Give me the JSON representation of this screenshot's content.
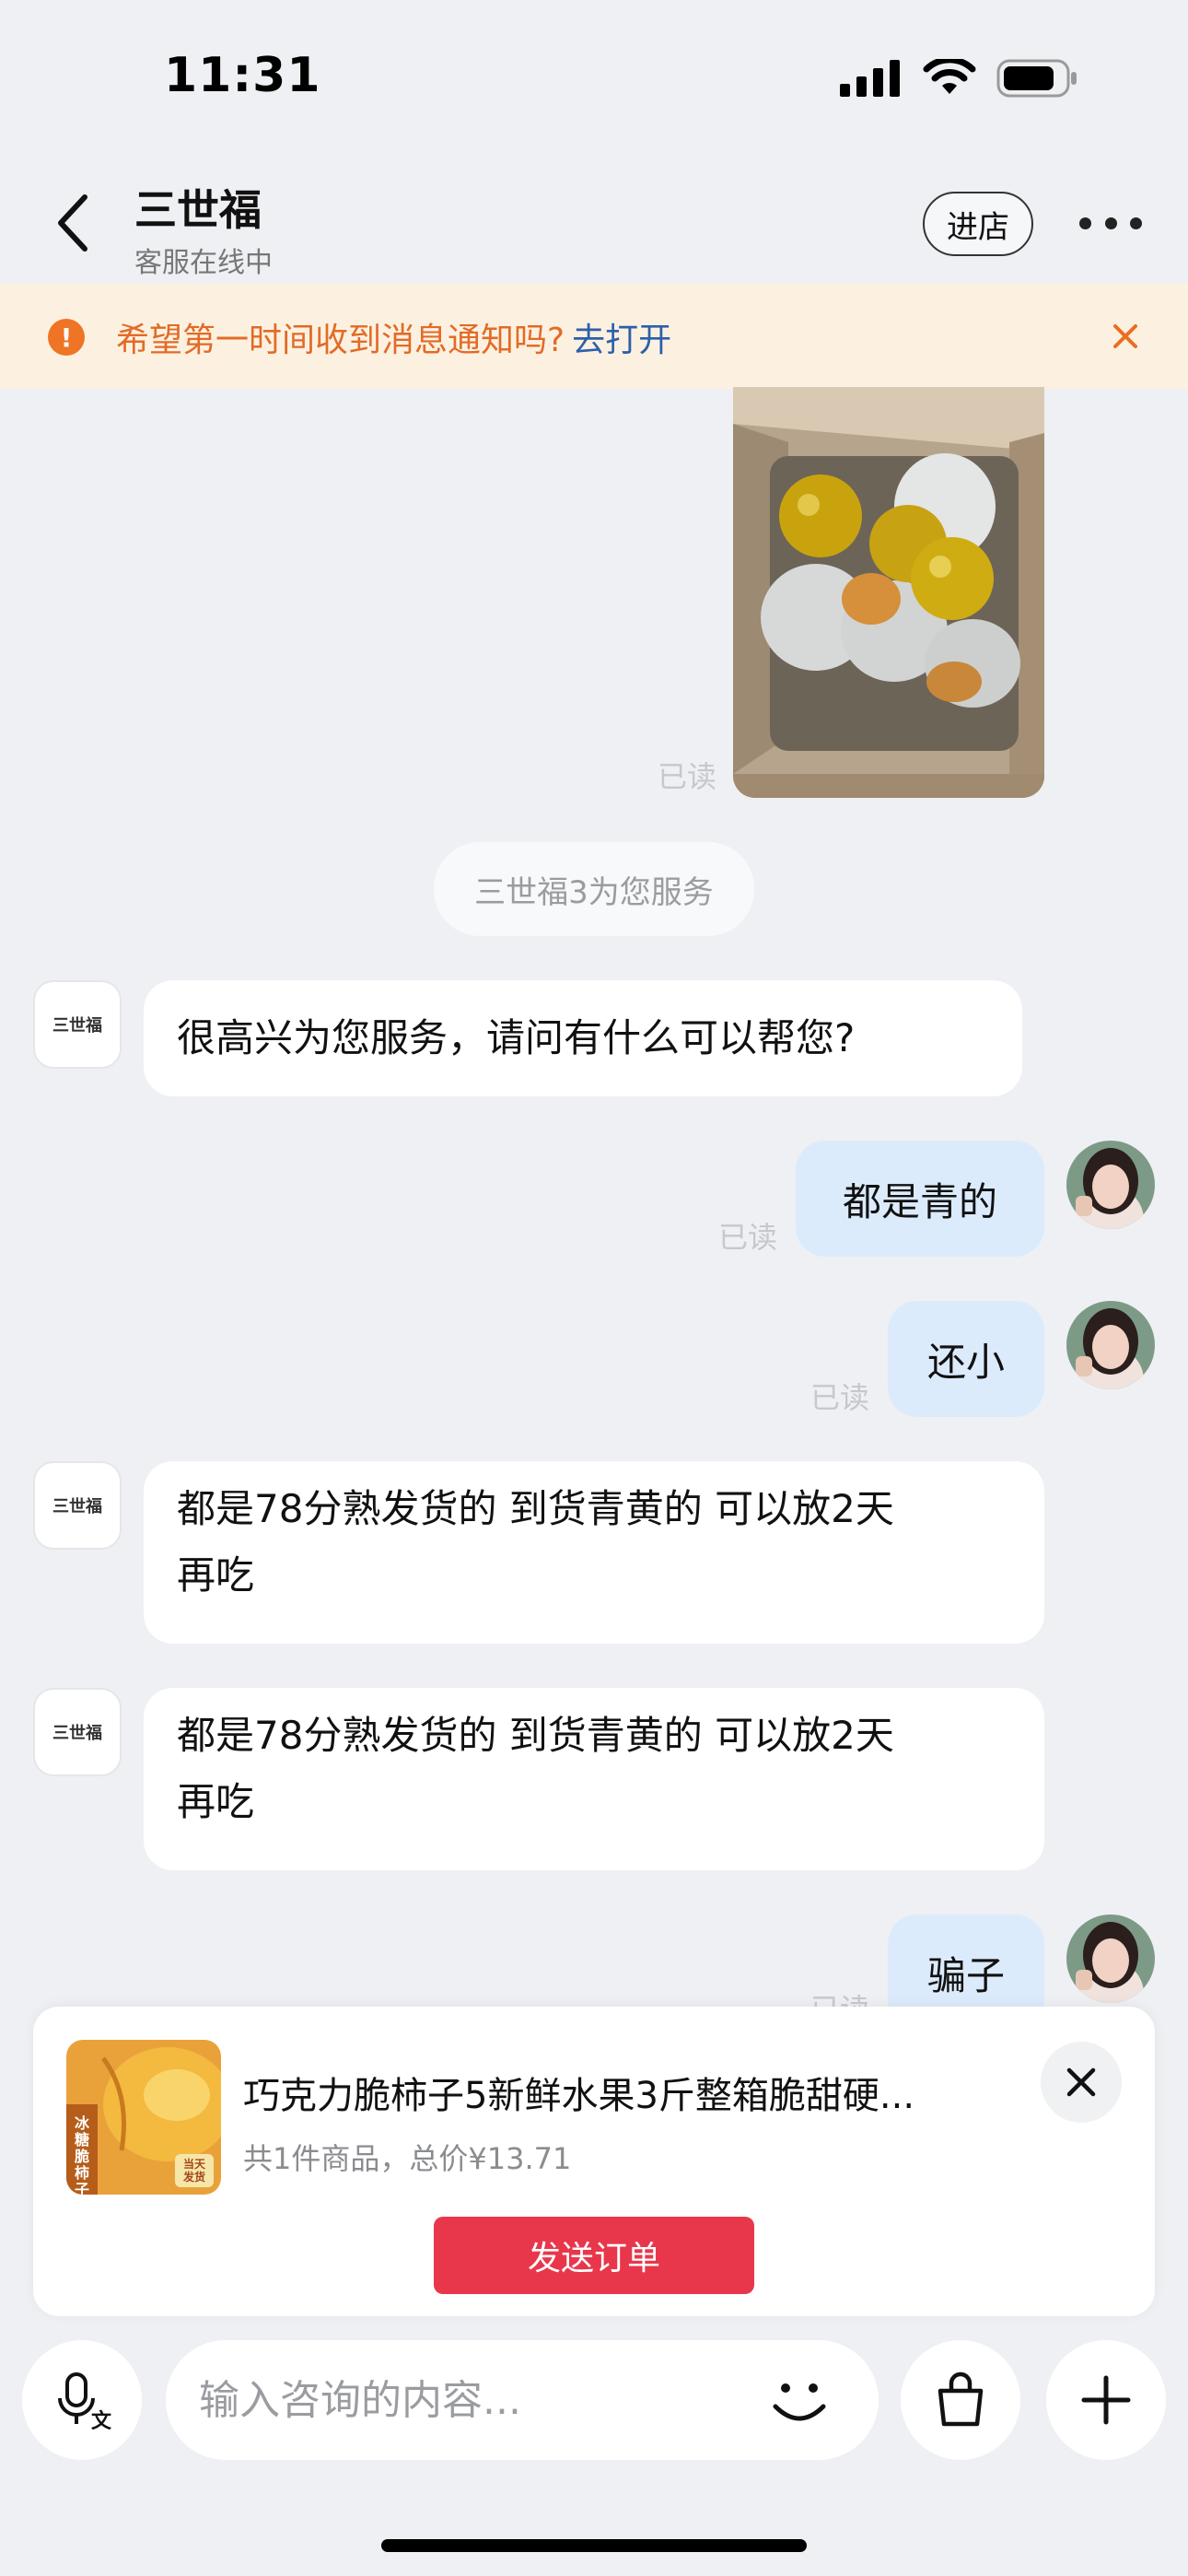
{
  "status_bar": {
    "time": "11:31"
  },
  "header": {
    "shop_name": "三世福",
    "shop_status": "客服在线中",
    "enter_shop_label": "进店"
  },
  "notice": {
    "text": "希望第一时间收到消息通知吗?",
    "link": "去打开"
  },
  "messages": {
    "photo_read": "已读",
    "system_chip": "三世福3为您服务",
    "shop_avatar_label": "三世福",
    "m1": "很高兴为您服务，请问有什么可以帮您?",
    "m2": "都是青的",
    "m2_read": "已读",
    "m3": "还小",
    "m3_read": "已读",
    "m4_line1": "都是78分熟发货的 到货青黄的 可以放2天",
    "m4_line2": "再吃",
    "m5_line1": "都是78分熟发货的 到货青黄的 可以放2天",
    "m5_line2": "再吃",
    "m6": "骗子",
    "m6_read": "已读"
  },
  "order_card": {
    "title": "巧克力脆柿子5新鲜水果3斤整箱脆甜硬...",
    "summary": "共1件商品，总价¥13.71",
    "send_label": "发送订单",
    "thumb_text_main": "冰糖脆柿子",
    "thumb_text_badge": "当天发货"
  },
  "input_bar": {
    "placeholder": "输入咨询的内容..."
  },
  "colors": {
    "accent_red": "#e8374b",
    "user_bubble": "#dcebfb",
    "notice_bg": "#fcf1e1",
    "notice_text": "#e26b26",
    "notice_link": "#2e5faa"
  }
}
